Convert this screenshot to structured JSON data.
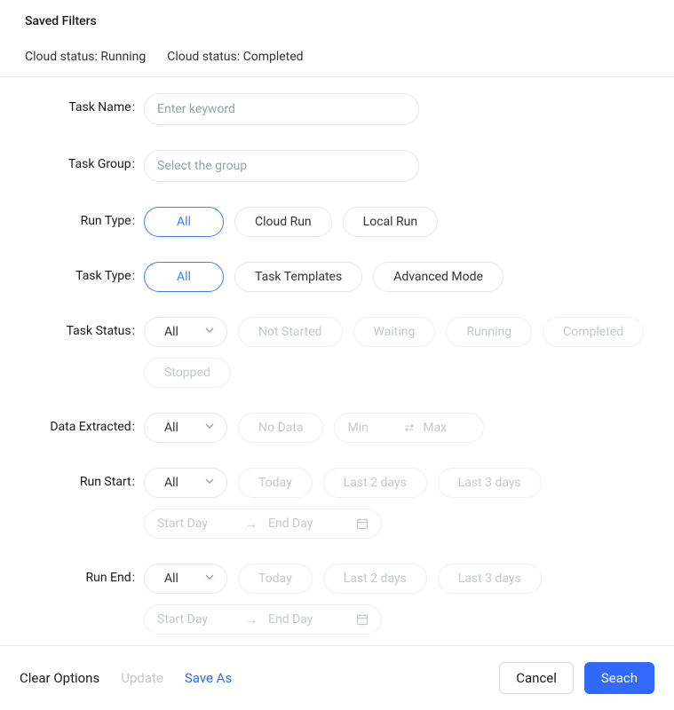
{
  "header": {
    "title": "Saved Filters"
  },
  "savedFilters": [
    "Cloud status: Running",
    "Cloud status: Completed"
  ],
  "form": {
    "taskName": {
      "label": "Task Name",
      "placeholder": "Enter keyword",
      "value": ""
    },
    "taskGroup": {
      "label": "Task Group",
      "placeholder": "Select the group",
      "value": ""
    },
    "runType": {
      "label": "Run Type",
      "options": [
        "All",
        "Cloud Run",
        "Local Run"
      ],
      "selected": "All"
    },
    "taskType": {
      "label": "Task Type",
      "options": [
        "All",
        "Task Templates",
        "Advanced Mode"
      ],
      "selected": "All"
    },
    "taskStatus": {
      "label": "Task Status",
      "select": "All",
      "options": [
        "Not Started",
        "Waiting",
        "Running",
        "Completed",
        "Stopped"
      ]
    },
    "dataExtracted": {
      "label": "Data Extracted",
      "select": "All",
      "noData": "No Data",
      "min_ph": "Min",
      "max_ph": "Max"
    },
    "runStart": {
      "label": "Run Start",
      "select": "All",
      "options": [
        "Today",
        "Last 2 days",
        "Last 3 days"
      ],
      "start_ph": "Start Day",
      "end_ph": "End Day"
    },
    "runEnd": {
      "label": "Run End",
      "select": "All",
      "options": [
        "Today",
        "Last 2 days",
        "Last 3 days"
      ],
      "start_ph": "Start Day",
      "end_ph": "End Day"
    }
  },
  "footer": {
    "clear": "Clear Options",
    "update": "Update",
    "saveAs": "Save As",
    "cancel": "Cancel",
    "search": "Seach"
  }
}
